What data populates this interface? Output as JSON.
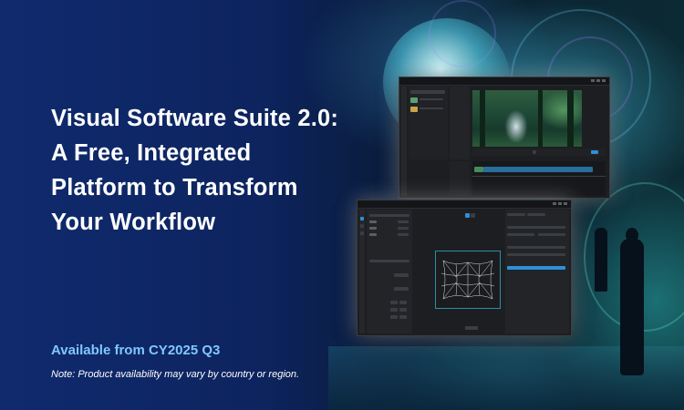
{
  "promo": {
    "headline_lines": [
      "Visual Software Suite 2.0:",
      "A Free, Integrated",
      "Platform to Transform",
      "Your Workflow"
    ],
    "availability": "Available from CY2025 Q3",
    "note": "Note: Product availability may vary by country or region."
  },
  "colors": {
    "headline": "#ffffff",
    "availability": "#7fc8ff",
    "background_left": "#102a6e",
    "app_window": "#1d1e21",
    "accent": "#2f8fd8"
  },
  "icons": {
    "window_minimize": "minimize-icon",
    "window_maximize": "maximize-icon",
    "window_close": "close-icon",
    "play": "play-icon"
  }
}
